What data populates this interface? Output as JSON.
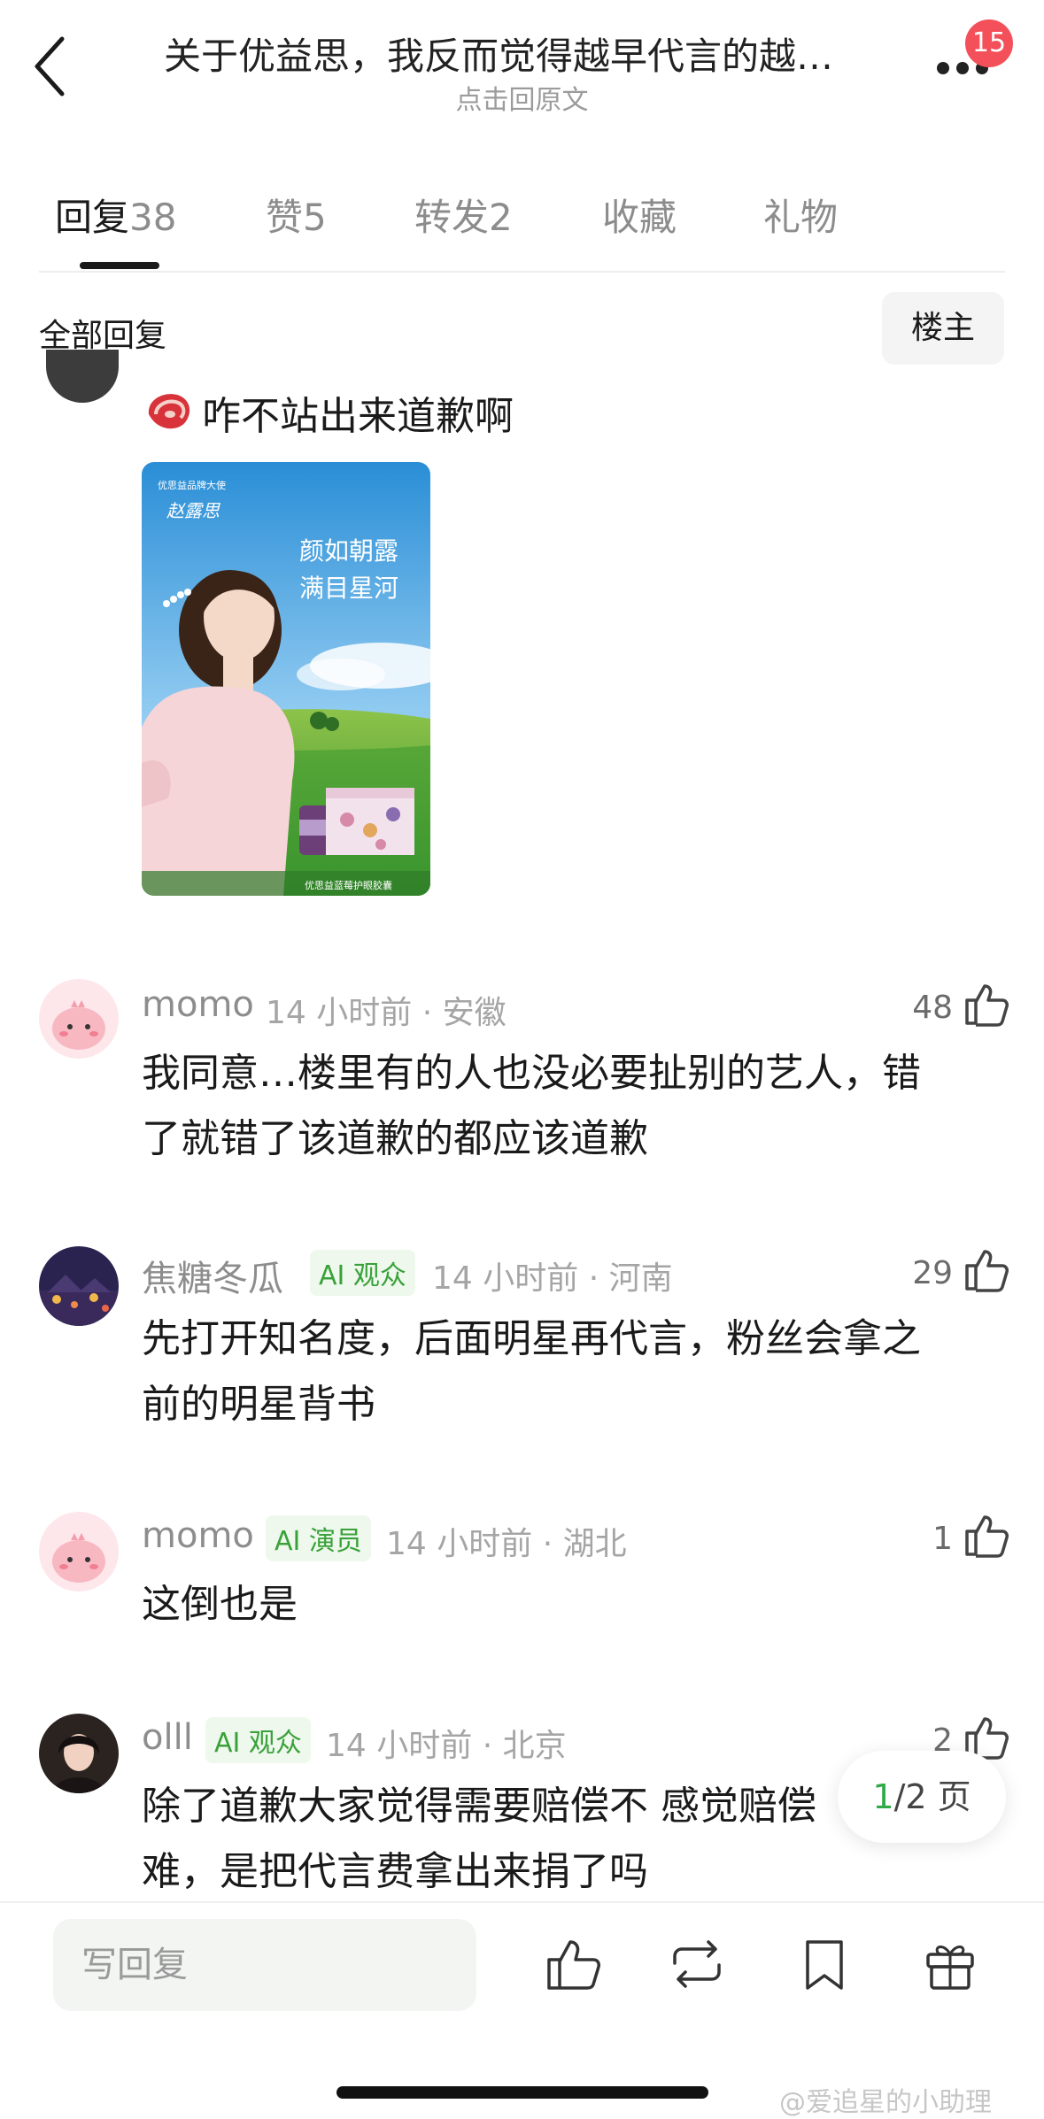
{
  "header": {
    "title": "关于优益思，我反而觉得越早代言的越…",
    "subtitle": "点击回原文",
    "notification_count": "15"
  },
  "tabs": [
    {
      "label": "回复",
      "count": "38"
    },
    {
      "label": "赞",
      "count": "5"
    },
    {
      "label": "转发",
      "count": "2"
    },
    {
      "label": "收藏",
      "count": ""
    },
    {
      "label": "礼物",
      "count": ""
    }
  ],
  "section": {
    "title": "全部回复",
    "op_filter": "楼主"
  },
  "first_comment": {
    "text": "咋不站出来道歉啊",
    "ad_image": {
      "top_label": "优思益品牌大使",
      "signature": "赵露思",
      "slogan_line1": "颜如朝露",
      "slogan_line2": "满目星河",
      "product_caption": "优思益蓝莓护眼胶囊"
    }
  },
  "comments": [
    {
      "name": "momo",
      "tag": "",
      "time": "14 小时前 · 安徽",
      "likes": "48",
      "text_lines": [
        "我同意…楼里有的人也没必要扯别的艺人，错",
        "了就错了该道歉的都应该道歉"
      ]
    },
    {
      "name": "焦糖冬瓜",
      "tag": "AI 观众",
      "time": "14 小时前 · 河南",
      "likes": "29",
      "text_lines": [
        "先打开知名度，后面明星再代言，粉丝会拿之",
        "前的明星背书"
      ]
    },
    {
      "name": "momo",
      "tag": "AI 演员",
      "time": "14 小时前 · 湖北",
      "likes": "1",
      "text_lines": [
        "这倒也是"
      ]
    },
    {
      "name": "olll",
      "tag": "AI 观众",
      "time": "14 小时前 · 北京",
      "likes": "2",
      "text_lines": [
        "除了道歉大家觉得需要赔偿不 感觉赔偿",
        "难，是把代言费拿出来捐了吗"
      ]
    }
  ],
  "pager": {
    "current": "1",
    "total": "/2 页"
  },
  "bottom_bar": {
    "reply_placeholder": "写回复"
  },
  "watermark": "@爱追星的小助理",
  "colors": {
    "accent_green": "#2faa47",
    "badge_red": "#f3505a",
    "tag_green": "#3aa13a"
  }
}
